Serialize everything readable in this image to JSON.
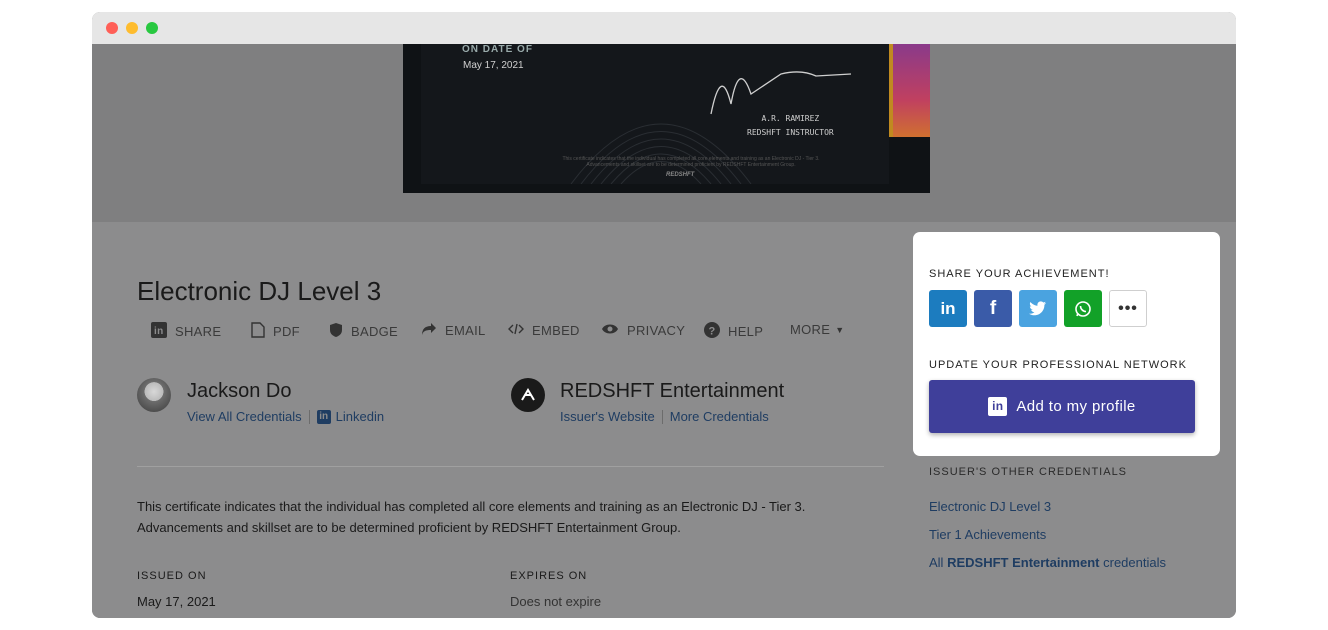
{
  "certificate": {
    "on_date_label": "ON DATE OF",
    "date": "May 17, 2021",
    "instructor_name": "A.R. RAMIREZ",
    "instructor_title": "REDSHFT INSTRUCTOR",
    "fine_print": "This certificate indicates that the individual has completed all core elements and training as an Electronic DJ - Tier 3. Advancements and skillset are to be determined proficient by REDSHFT Entertainment Group.",
    "logo_text": "REDSHFT"
  },
  "credential": {
    "title": "Electronic DJ Level 3",
    "description_line1": "This certificate indicates that the individual has completed all core elements and training as an Electronic DJ - Tier 3.",
    "description_line2": "Advancements and skillset are to be determined proficient by REDSHFT Entertainment Group.",
    "issued_label": "ISSUED ON",
    "issued_value": "May 17, 2021",
    "expires_label": "EXPIRES ON",
    "expires_value": "Does not expire"
  },
  "actions": [
    {
      "label": "SHARE",
      "icon": "linkedin-icon"
    },
    {
      "label": "PDF",
      "icon": "pdf-icon"
    },
    {
      "label": "BADGE",
      "icon": "shield-icon"
    },
    {
      "label": "EMAIL",
      "icon": "share-arrow-icon"
    },
    {
      "label": "EMBED",
      "icon": "code-icon"
    },
    {
      "label": "PRIVACY",
      "icon": "eye-icon"
    },
    {
      "label": "HELP",
      "icon": "help-icon"
    },
    {
      "label": "MORE",
      "icon": "caret-down-icon"
    }
  ],
  "recipient": {
    "name": "Jackson Do",
    "link1": "View All Credentials",
    "link2": "Linkedin"
  },
  "issuer": {
    "name": "REDSHFT Entertainment",
    "link1": "Issuer's Website",
    "link2": "More Credentials"
  },
  "share_panel": {
    "heading": "SHARE YOUR ACHIEVEMENT!",
    "buttons": [
      {
        "network": "LinkedIn",
        "icon": "linkedin-icon",
        "color": "#1c7cbf"
      },
      {
        "network": "Facebook",
        "icon": "facebook-icon",
        "color": "#3a5ba8"
      },
      {
        "network": "Twitter",
        "icon": "twitter-icon",
        "color": "#4aa3e0"
      },
      {
        "network": "WhatsApp",
        "icon": "whatsapp-icon",
        "color": "#12a128"
      },
      {
        "network": "More",
        "icon": "more-icon",
        "color": "#ffffff"
      }
    ],
    "network_heading": "UPDATE YOUR PROFESSIONAL NETWORK",
    "add_button": "Add to my profile"
  },
  "other_credentials": {
    "heading": "ISSUER'S OTHER CREDENTIALS",
    "items": [
      "Electronic DJ Level 3",
      "Tier 1 Achievements"
    ],
    "all_prefix": "All",
    "all_issuer": "REDSHFT Entertainment",
    "all_suffix": "credentials"
  },
  "colors": {
    "overlay": "#8c8c8d",
    "link": "#1f3d62",
    "accent": "#3f3f9a"
  }
}
